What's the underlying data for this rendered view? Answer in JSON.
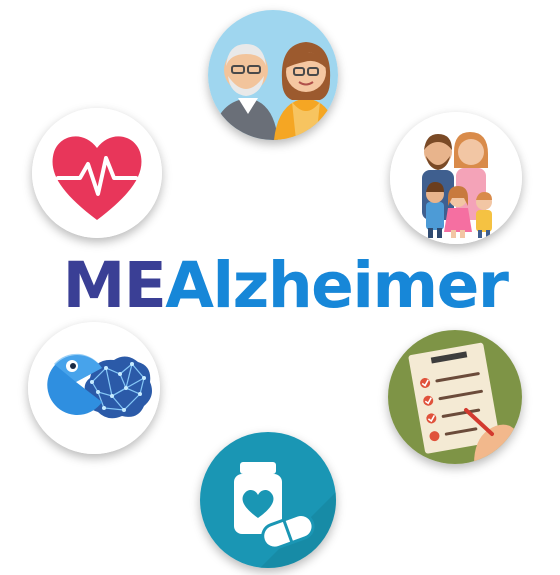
{
  "logo": {
    "part1": "ME",
    "part2": "Alzheimer"
  },
  "icons": [
    {
      "name": "elderly-couple-icon"
    },
    {
      "name": "heart-rate-icon"
    },
    {
      "name": "family-icon"
    },
    {
      "name": "brain-game-icon"
    },
    {
      "name": "checklist-icon"
    },
    {
      "name": "medication-icon"
    }
  ],
  "colors": {
    "logo_part1": "#3a3f95",
    "logo_part2": "#1787d8",
    "heart": "#e8365a",
    "meds_bg": "#1a96b4",
    "checklist_bg": "#7e9446",
    "elderly_bg": "#9fd6ef"
  }
}
